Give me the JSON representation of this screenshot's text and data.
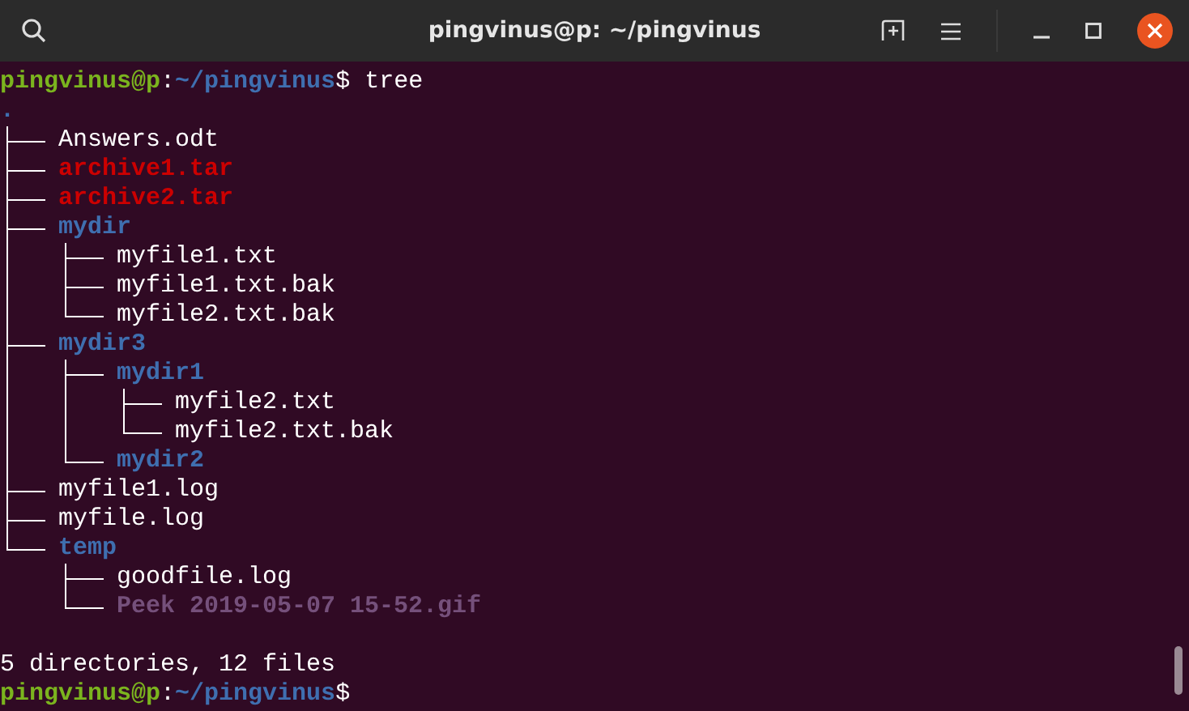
{
  "window": {
    "title": "pingvinus@p: ~/pingvinus"
  },
  "terminal": {
    "command_line": {
      "user_host": "pingvinus@p",
      "separator": ":",
      "path": "~/pingvinus",
      "prompt_symbol": "$",
      "command": "tree"
    },
    "tree": {
      "name": ".",
      "kind": "dir",
      "children": [
        {
          "name": "Answers.odt",
          "kind": "file"
        },
        {
          "name": "archive1.tar",
          "kind": "archive"
        },
        {
          "name": "archive2.tar",
          "kind": "archive"
        },
        {
          "name": "mydir",
          "kind": "dir",
          "children": [
            {
              "name": "myfile1.txt",
              "kind": "file"
            },
            {
              "name": "myfile1.txt.bak",
              "kind": "file"
            },
            {
              "name": "myfile2.txt.bak",
              "kind": "file"
            }
          ]
        },
        {
          "name": "mydir3",
          "kind": "dir",
          "children": [
            {
              "name": "mydir1",
              "kind": "dir",
              "children": [
                {
                  "name": "myfile2.txt",
                  "kind": "file"
                },
                {
                  "name": "myfile2.txt.bak",
                  "kind": "file"
                }
              ]
            },
            {
              "name": "mydir2",
              "kind": "dir"
            }
          ]
        },
        {
          "name": "myfile1.log",
          "kind": "file"
        },
        {
          "name": "myfile.log",
          "kind": "file"
        },
        {
          "name": "temp",
          "kind": "dir",
          "children": [
            {
              "name": "goodfile.log",
              "kind": "file"
            },
            {
              "name": "Peek 2019-05-07 15-52.gif",
              "kind": "image"
            }
          ]
        }
      ]
    },
    "summary": "5 directories, 12 files",
    "prompt_line": {
      "user_host": "pingvinus@p",
      "separator": ":",
      "path": "~/pingvinus",
      "prompt_symbol": "$"
    }
  }
}
